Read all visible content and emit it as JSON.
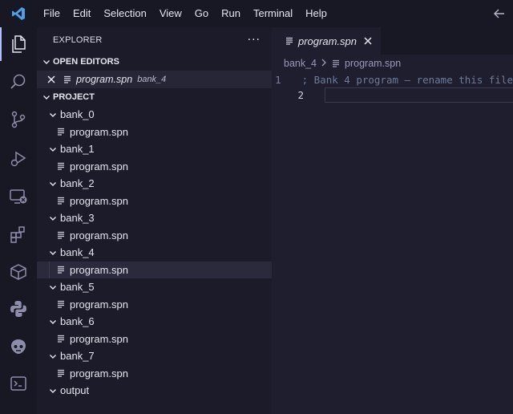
{
  "menu": [
    "File",
    "Edit",
    "Selection",
    "View",
    "Go",
    "Run",
    "Terminal",
    "Help"
  ],
  "sidebar": {
    "title": "EXPLORER",
    "more": "···",
    "open_editors": {
      "label": "OPEN EDITORS",
      "items": [
        {
          "name": "program.spn",
          "desc": "bank_4"
        }
      ]
    },
    "project": {
      "label": "PROJECT",
      "folders": [
        {
          "name": "bank_0",
          "file": "program.spn"
        },
        {
          "name": "bank_1",
          "file": "program.spn"
        },
        {
          "name": "bank_2",
          "file": "program.spn"
        },
        {
          "name": "bank_3",
          "file": "program.spn"
        },
        {
          "name": "bank_4",
          "file": "program.spn"
        },
        {
          "name": "bank_5",
          "file": "program.spn"
        },
        {
          "name": "bank_6",
          "file": "program.spn"
        },
        {
          "name": "bank_7",
          "file": "program.spn"
        },
        {
          "name": "output"
        }
      ]
    }
  },
  "editor": {
    "tab": {
      "name": "program.spn"
    },
    "breadcrumb": {
      "folder": "bank_4",
      "file": "program.spn"
    },
    "lines": [
      {
        "num": "1",
        "text": "; Bank 4 program – rename this file"
      },
      {
        "num": "2",
        "text": ""
      }
    ]
  },
  "colors": {
    "accent": "#b4befe",
    "logo": "#4f9ee8"
  }
}
